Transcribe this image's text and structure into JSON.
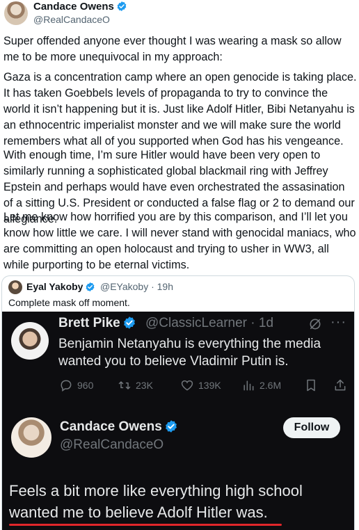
{
  "header": {
    "name": "Candace Owens",
    "handle": "@RealCandaceO",
    "verified_color": "#1d9bf0"
  },
  "tweet": {
    "paragraphs": [
      "Super offended anyone ever thought I was wearing a mask so allow me to be more unequivocal in my approach:",
      "Gaza is a concentration camp where an open genocide is taking place. It has taken Goebbels levels of propaganda to try to convince the world it isn’t happening but it is. Just like Adolf Hitler, Bibi Netanyahu is an ethnocentric imperialist monster and we will make sure the world remembers what all of you supported when God has his vengeance.",
      "With enough time, I’m sure Hitler would have been very open to similarly running a sophisticated global blackmail ring with Jeffrey Epstein and perhaps would have even orchestrated the assasination of a sitting U.S. President or conducted a false flag or 2 to demand our allegiance.",
      "Let me know how horrified you are by this comparison, and I’ll let you know how little we care. I will never stand with genocidal maniacs, who are committing an open holocaust and trying to usher in WW3, all while purporting to be eternal victims."
    ]
  },
  "quote": {
    "name": "Eyal Yakoby",
    "meta": "@EYakoby · 19h",
    "text": "Complete mask off moment.",
    "screenshot": {
      "first": {
        "name": "Brett Pike",
        "handle": "@ClassicLearner · 1d",
        "more": "···",
        "text": "Benjamin Netanyahu is everything the media wanted you to believe Vladimir Putin is.",
        "actions": {
          "replies": "960",
          "reposts": "23K",
          "likes": "139K",
          "views": "2.6M"
        }
      },
      "second": {
        "name": "Candace Owens",
        "handle": "@RealCandaceO",
        "follow_label": "Follow",
        "text": "Feels a bit more like everything high school wanted me to believe Adolf Hitler was."
      },
      "underline_color": "#e0262a"
    }
  },
  "icons": [
    "verified-badge-icon",
    "grok-icon",
    "more-icon",
    "reply-icon",
    "repost-icon",
    "like-icon",
    "views-icon",
    "bookmark-icon",
    "share-icon"
  ]
}
